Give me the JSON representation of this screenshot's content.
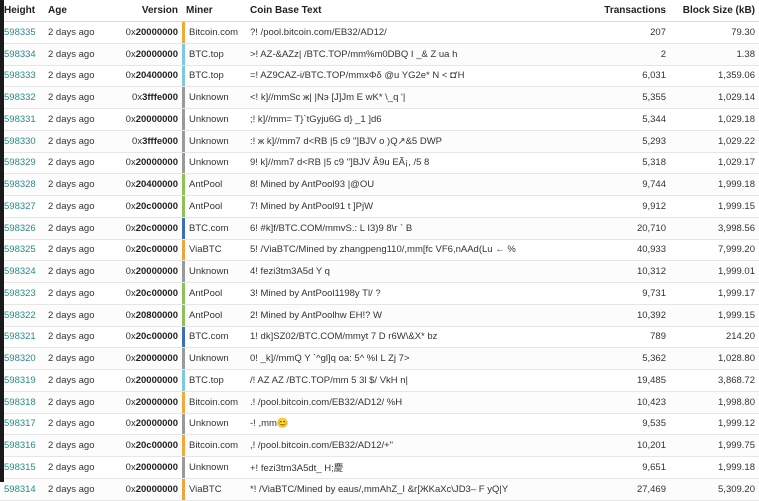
{
  "columns": {
    "height": "Height",
    "age": "Age",
    "version": "Version",
    "miner": "Miner",
    "coinbase": "Coin Base Text",
    "transactions": "Transactions",
    "block_size": "Block Size (kB)"
  },
  "miner_colors": {
    "Bitcoin.com": "#f0a93a",
    "BTC.top": "#7ec8e3",
    "Unknown": "#9a9a9a",
    "AntPool": "#8fbf5a",
    "BTC.com": "#3b6fb6",
    "ViaBTC": "#f2a33a"
  },
  "rows": [
    {
      "height": "598335",
      "age": "2 days ago",
      "version_prefix": "0x",
      "version_hex": "20000000",
      "miner": "Bitcoin.com",
      "coinbase": "?! /pool.bitcoin.com/EB32/AD12/",
      "tx": "207",
      "size": "79.30"
    },
    {
      "height": "598334",
      "age": "2 days ago",
      "version_prefix": "0x",
      "version_hex": "20000000",
      "miner": "BTC.top",
      "coinbase": ">! AZ-&AZz| /BTC.TOP/mm%m0DBQ I _& Z ua h",
      "tx": "2",
      "size": "1.38"
    },
    {
      "height": "598333",
      "age": "2 days ago",
      "version_prefix": "0x",
      "version_hex": "20400000",
      "miner": "BTC.top",
      "coinbase": "=! AZ9CAZ-i/BTC.TOP/mmxΦδ @u YG2e* N  < ◘'H",
      "tx": "6,031",
      "size": "1,359.06"
    },
    {
      "height": "598332",
      "age": "2 days ago",
      "version_prefix": "0x",
      "version_hex": "3fffe000",
      "miner": "Unknown",
      "coinbase": "<!  k]//mmSc ж|  |Nэ [J]Jm E wK* \\_q '|",
      "tx": "5,355",
      "size": "1,029.14"
    },
    {
      "height": "598331",
      "age": "2 days ago",
      "version_prefix": "0x",
      "version_hex": "20000000",
      "miner": "Unknown",
      "coinbase": ";!  k]//mm= T}`tGyju6G  d}  _1 ]d6",
      "tx": "5,344",
      "size": "1,029.18"
    },
    {
      "height": "598330",
      "age": "2 days ago",
      "version_prefix": "0x",
      "version_hex": "3fffe000",
      "miner": "Unknown",
      "coinbase": ":!  ж k]//mm7 d<RB |5 c9 \"]BJV o )Q↗&5 DWP",
      "tx": "5,293",
      "size": "1,029.22"
    },
    {
      "height": "598329",
      "age": "2 days ago",
      "version_prefix": "0x",
      "version_hex": "20000000",
      "miner": "Unknown",
      "coinbase": "9!  k]//mm7 d<RB |5 c9 \"]BJV Â9u EÃ¡,  /5 8",
      "tx": "5,318",
      "size": "1,029.17"
    },
    {
      "height": "598328",
      "age": "2 days ago",
      "version_prefix": "0x",
      "version_hex": "20400000",
      "miner": "AntPool",
      "coinbase": "8!  Mined by AntPool93 |@OU",
      "tx": "9,744",
      "size": "1,999.18"
    },
    {
      "height": "598327",
      "age": "2 days ago",
      "version_prefix": "0x",
      "version_hex": "20c00000",
      "miner": "AntPool",
      "coinbase": "7!  Mined by AntPool91 t ]PjW",
      "tx": "9,912",
      "size": "1,999.15"
    },
    {
      "height": "598326",
      "age": "2 days ago",
      "version_prefix": "0x",
      "version_hex": "20c00000",
      "miner": "BTC.com",
      "coinbase": "6!  #k]f/BTC.COM/mmvS.:  L I3)9   8\\r ` B",
      "tx": "20,710",
      "size": "3,998.56"
    },
    {
      "height": "598325",
      "age": "2 days ago",
      "version_prefix": "0x",
      "version_hex": "20c00000",
      "miner": "ViaBTC",
      "coinbase": "5!  /ViaBTC/Mined by zhangpeng110/,mm[fc   VF6,nAAd(Lu  ←  %",
      "tx": "40,933",
      "size": "7,999.20"
    },
    {
      "height": "598324",
      "age": "2 days ago",
      "version_prefix": "0x",
      "version_hex": "20000000",
      "miner": "Unknown",
      "coinbase": "4! fezi3tm3A5d Y q",
      "tx": "10,312",
      "size": "1,999.01"
    },
    {
      "height": "598323",
      "age": "2 days ago",
      "version_prefix": "0x",
      "version_hex": "20c00000",
      "miner": "AntPool",
      "coinbase": "3!  Mined by AntPool1198y Tl/ ?",
      "tx": "9,731",
      "size": "1,999.17"
    },
    {
      "height": "598322",
      "age": "2 days ago",
      "version_prefix": "0x",
      "version_hex": "20800000",
      "miner": "AntPool",
      "coinbase": "2!  Mined by AntPoolhw  EH!?  W",
      "tx": "10,392",
      "size": "1,999.15"
    },
    {
      "height": "598321",
      "age": "2 days ago",
      "version_prefix": "0x",
      "version_hex": "20c00000",
      "miner": "BTC.com",
      "coinbase": "1!  dk]SZ02/BTC.COM/mmyt 7 D r6W\\&X*  bz",
      "tx": "789",
      "size": "214.20"
    },
    {
      "height": "598320",
      "age": "2 days ago",
      "version_prefix": "0x",
      "version_hex": "20000000",
      "miner": "Unknown",
      "coinbase": "0!  _k]//mmQ  Y   `^gl]q oa:  5^ %I  L  Zj  7>",
      "tx": "5,362",
      "size": "1,028.80"
    },
    {
      "height": "598319",
      "age": "2 days ago",
      "version_prefix": "0x",
      "version_hex": "20000000",
      "miner": "BTC.top",
      "coinbase": "/! AZ  AZ  /BTC.TOP/mm  5 3l $/ VkH n|",
      "tx": "19,485",
      "size": "3,868.72"
    },
    {
      "height": "598318",
      "age": "2 days ago",
      "version_prefix": "0x",
      "version_hex": "20000000",
      "miner": "Bitcoin.com",
      "coinbase": ".! /pool.bitcoin.com/EB32/AD12/   %H",
      "tx": "10,423",
      "size": "1,998.80"
    },
    {
      "height": "598317",
      "age": "2 days ago",
      "version_prefix": "0x",
      "version_hex": "20000000",
      "miner": "Unknown",
      "coinbase": "-! ,mm😊",
      "tx": "9,535",
      "size": "1,999.12"
    },
    {
      "height": "598316",
      "age": "2 days ago",
      "version_prefix": "0x",
      "version_hex": "20c00000",
      "miner": "Bitcoin.com",
      "coinbase": ",! /pool.bitcoin.com/EB32/AD12/+\"",
      "tx": "10,201",
      "size": "1,999.75"
    },
    {
      "height": "598315",
      "age": "2 days ago",
      "version_prefix": "0x",
      "version_hex": "20000000",
      "miner": "Unknown",
      "coinbase": "+! fezi3tm3A5dt_   H;慶",
      "tx": "9,651",
      "size": "1,999.18"
    },
    {
      "height": "598314",
      "age": "2 days ago",
      "version_prefix": "0x",
      "version_hex": "20000000",
      "miner": "ViaBTC",
      "coinbase": "*!  /ViaBTC/Mined by eaus/,mmAhZ_I &r[ЖKaXc\\JD3–  F yQ|Y",
      "tx": "27,469",
      "size": "5,309.20"
    }
  ]
}
